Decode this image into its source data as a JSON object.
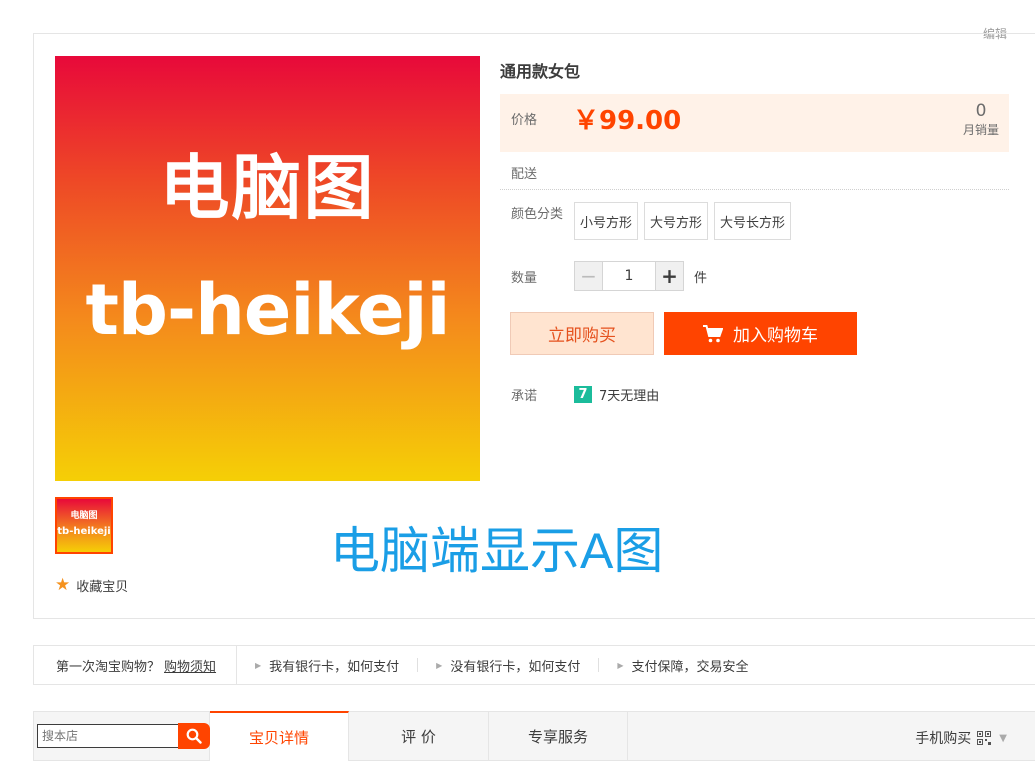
{
  "edit_link": "编辑",
  "gallery": {
    "main_image_line1": "电脑图",
    "main_image_line2": "tb-heikeji",
    "thumb_line1": "电脑图",
    "thumb_line2": "tb-heikeji",
    "favorite_label": "收藏宝贝",
    "overlay_text": "电脑端显示A图"
  },
  "product": {
    "title": "通用款女包",
    "price_label": "价格",
    "price": "￥99.00",
    "sales_count": "0",
    "sales_label": "月销量",
    "delivery_label": "配送",
    "color_label": "颜色分类",
    "skus": [
      "小号方形",
      "大号方形",
      "大号长方形"
    ],
    "quantity_label": "数量",
    "quantity_value": "1",
    "quantity_minus": "−",
    "quantity_plus": "+",
    "quantity_unit": "件",
    "buy_now_label": "立即购买",
    "add_cart_label": "加入购物车",
    "promise_label": "承诺",
    "promise_icon_text": "7",
    "promise_text": "7天无理由"
  },
  "guide": {
    "first_text": "第一次淘宝购物？",
    "first_link": "购物须知",
    "items": [
      "我有银行卡，如何支付",
      "没有银行卡，如何支付",
      "支付保障，交易安全"
    ]
  },
  "store_search": {
    "placeholder": "搜本店"
  },
  "tabs": {
    "items": [
      "宝贝详情",
      "评 价",
      "专享服务"
    ],
    "mobile_buy": "手机购买"
  },
  "colors": {
    "accent": "#ff4400",
    "price_bg": "#fff2e8",
    "overlay_blue": "#1a9ee6",
    "promise_green": "#1bbc9b"
  }
}
